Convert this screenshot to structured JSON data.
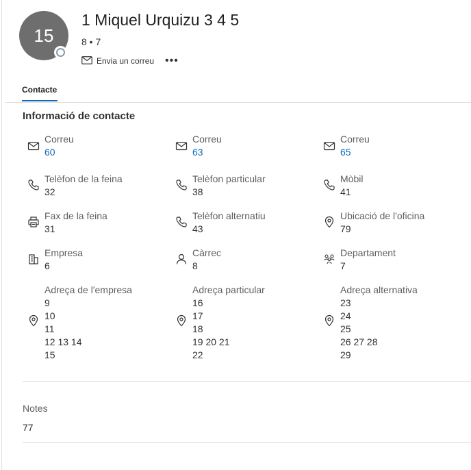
{
  "contact": {
    "avatar_initials": "15",
    "name": "1 Miquel Urquizu 3 4 5",
    "subtitle": "8 • 7",
    "send_email_label": "Envia un correu",
    "more_label": "•••"
  },
  "tabs": [
    {
      "label": "Contacte",
      "selected": true
    }
  ],
  "section_title": "Informació de contacte",
  "fields": {
    "email1": {
      "label": "Correu",
      "value": "60",
      "icon": "mail-icon"
    },
    "email2": {
      "label": "Correu",
      "value": "63",
      "icon": "mail-icon"
    },
    "email3": {
      "label": "Correu",
      "value": "65",
      "icon": "mail-icon"
    },
    "work_phone": {
      "label": "Telèfon de la feina",
      "value": "32",
      "icon": "phone-icon"
    },
    "home_phone": {
      "label": "Telèfon particular",
      "value": "38",
      "icon": "phone-icon"
    },
    "mobile": {
      "label": "Mòbil",
      "value": "41",
      "icon": "phone-icon"
    },
    "work_fax": {
      "label": "Fax de la feina",
      "value": "31",
      "icon": "fax-icon"
    },
    "alt_phone": {
      "label": "Telèfon alternatiu",
      "value": "43",
      "icon": "phone-icon"
    },
    "office_location": {
      "label": "Ubicació de l'oficina",
      "value": "79",
      "icon": "location-icon"
    },
    "company": {
      "label": "Empresa",
      "value": "6",
      "icon": "building-icon"
    },
    "job_title": {
      "label": "Càrrec",
      "value": "8",
      "icon": "person-icon"
    },
    "department": {
      "label": "Departament",
      "value": "7",
      "icon": "people-team-icon"
    },
    "business_address": {
      "label": "Adreça de l'empresa",
      "lines": [
        "9",
        "10",
        "11",
        "12 13 14",
        "15"
      ],
      "icon": "location-icon"
    },
    "home_address": {
      "label": "Adreça particular",
      "lines": [
        "16",
        "17",
        "18",
        "19 20 21",
        "22"
      ],
      "icon": "location-icon"
    },
    "alt_address": {
      "label": "Adreça alternativa",
      "lines": [
        "23",
        "24",
        "25",
        "26 27 28",
        "29"
      ],
      "icon": "location-icon"
    }
  },
  "notes": {
    "label": "Notes",
    "value": "77"
  },
  "colors": {
    "accent": "#0f6cbd",
    "avatar": "#6e6e6e",
    "divider": "#e1dfdd"
  }
}
